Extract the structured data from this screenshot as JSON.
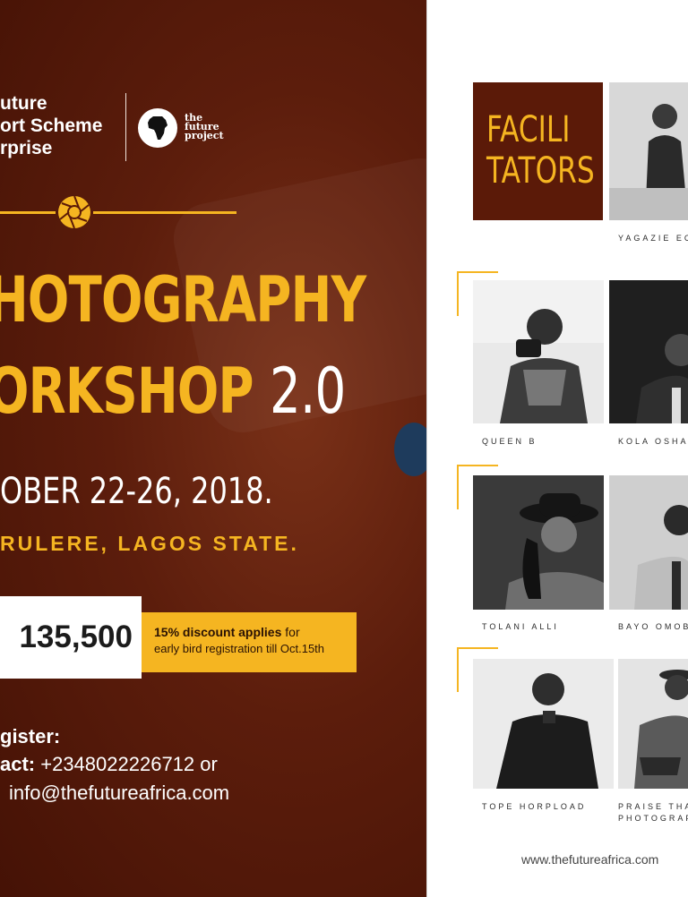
{
  "brand": {
    "line1": "uture",
    "line2": "ort Scheme",
    "line3": "rprise",
    "partner_logo": "africa-map-icon",
    "partner_name_line1": "the",
    "partner_name_line2": "future",
    "partner_name_line3": "project"
  },
  "divider_icon": "camera-shutter-icon",
  "title": {
    "line1": "HOTOGRAPHY",
    "line2": "ORKSHOP",
    "version": "2.0"
  },
  "event": {
    "date": "OBER 22-26, 2018.",
    "venue": "RULERE, LAGOS STATE."
  },
  "pricing": {
    "price": "135,500",
    "discount_bold": "15% discount applies",
    "discount_rest": " for",
    "discount_line2": "early bird registration till Oct.15th"
  },
  "register": {
    "heading": "gister:",
    "contact_label": "act:",
    "contact_phone": " +2348022226712 or",
    "email": "info@thefutureafrica.com"
  },
  "facilitators": {
    "heading_line1": "FACILI",
    "heading_line2": "TATORS",
    "people": [
      {
        "caption": "YAGAZIE EC"
      },
      {
        "caption": "QUEEN B"
      },
      {
        "caption": "KOLA OSHAL"
      },
      {
        "caption": "TOLANI ALLI"
      },
      {
        "caption": "BAYO OMOBO"
      },
      {
        "caption": "TOPE HORPLOAD"
      },
      {
        "caption": "PRAISE THAT"
      },
      {
        "caption": "PHOTOGRAPI"
      }
    ]
  },
  "footer": {
    "url": "www.thefutureafrica.com"
  },
  "colors": {
    "accent_yellow": "#f5b521",
    "maroon": "#5b1a08",
    "background_right": "#ffffff"
  }
}
